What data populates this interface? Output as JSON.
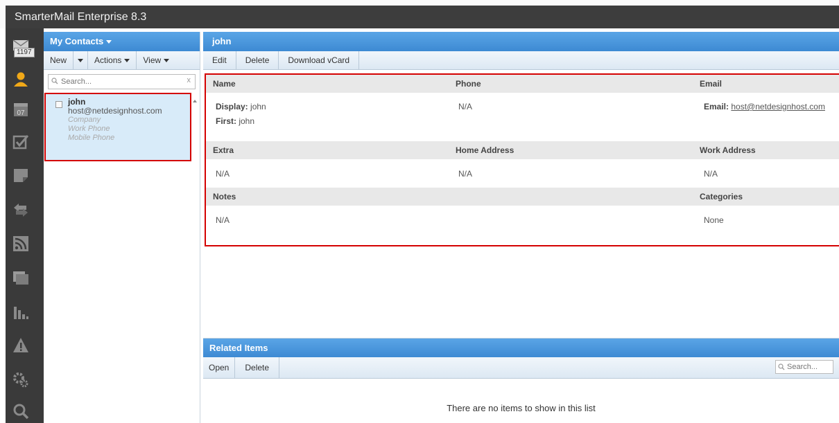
{
  "app": {
    "title": "SmarterMail Enterprise 8.3"
  },
  "rail": {
    "mail_badge": "1197",
    "icons": [
      "mail-icon",
      "contacts-icon",
      "calendar-icon",
      "tasks-icon",
      "notes-icon",
      "sync-icon",
      "rss-icon",
      "files-icon",
      "reports-icon",
      "alerts-icon",
      "settings-icon",
      "search-icon"
    ],
    "calendar_day": "07"
  },
  "contacts_panel": {
    "title": "My Contacts",
    "toolbar": {
      "new_label": "New",
      "actions_label": "Actions",
      "view_label": "View"
    },
    "search": {
      "placeholder": "Search...",
      "clear": "x"
    },
    "items": [
      {
        "name": "john",
        "email": "host@netdesignhost.com",
        "company": "Company",
        "work_phone": "Work Phone",
        "mobile_phone": "Mobile Phone"
      }
    ]
  },
  "detail": {
    "title": "john",
    "toolbar": {
      "edit_label": "Edit",
      "delete_label": "Delete",
      "vcard_label": "Download vCard"
    },
    "sections": {
      "name_header": "Name",
      "phone_header": "Phone",
      "email_header": "Email",
      "display_label": "Display:",
      "display_value": "john",
      "first_label": "First:",
      "first_value": "john",
      "phone_value": "N/A",
      "email_label": "Email:",
      "email_value": "host@netdesignhost.com",
      "extra_header": "Extra",
      "home_address_header": "Home Address",
      "work_address_header": "Work Address",
      "extra_value": "N/A",
      "home_address_value": "N/A",
      "work_address_value": "N/A",
      "notes_header": "Notes",
      "categories_header": "Categories",
      "notes_value": "N/A",
      "categories_value": "None"
    }
  },
  "related": {
    "title": "Related Items",
    "toolbar": {
      "open_label": "Open",
      "delete_label": "Delete"
    },
    "search": {
      "placeholder": "Search..."
    },
    "empty_message": "There are no items to show in this list"
  },
  "colors": {
    "header_blue": "#4a97de",
    "toolbar_bg": "#e6eff8",
    "highlight_red": "#d40000",
    "rail_bg": "#3a3a3a",
    "selected_row": "#d8ebf9"
  }
}
